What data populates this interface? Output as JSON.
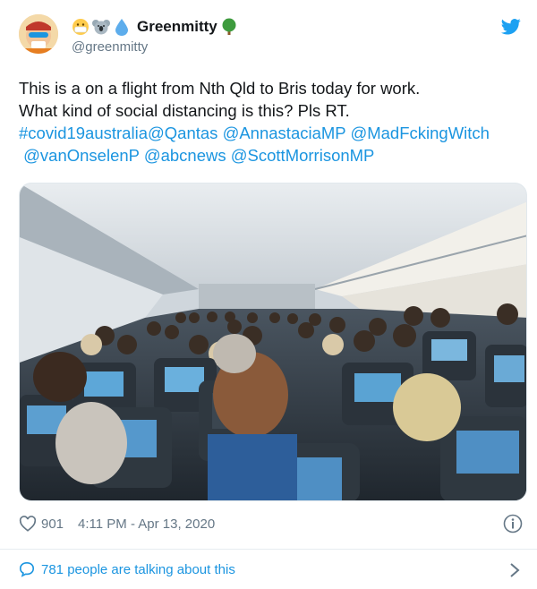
{
  "user": {
    "display_name": "Greenmitty",
    "handle": "@greenmitty",
    "name_emojis": [
      "face-with-mask-icon",
      "koala-icon",
      "droplet-icon",
      "tree-icon"
    ]
  },
  "tweet": {
    "line1": "This is a on a flight from Nth Qld to Bris today for work.",
    "line2": "What kind of social distancing is this? Pls RT.",
    "line3_links": [
      "#covid19australia",
      "@Qantas",
      "@AnnastaciaMP",
      "@MadFckingWitch"
    ],
    "line4_links": [
      "@vanOnselenP",
      "@abcnews",
      "@ScottMorrisonMP"
    ]
  },
  "footer": {
    "likes": "901",
    "timestamp": "4:11 PM - Apr 13, 2020",
    "talking": "781 people are talking about this"
  },
  "colors": {
    "link": "#1b95e0",
    "muted": "#657786",
    "text": "#14171a",
    "brand": "#1da1f2"
  }
}
